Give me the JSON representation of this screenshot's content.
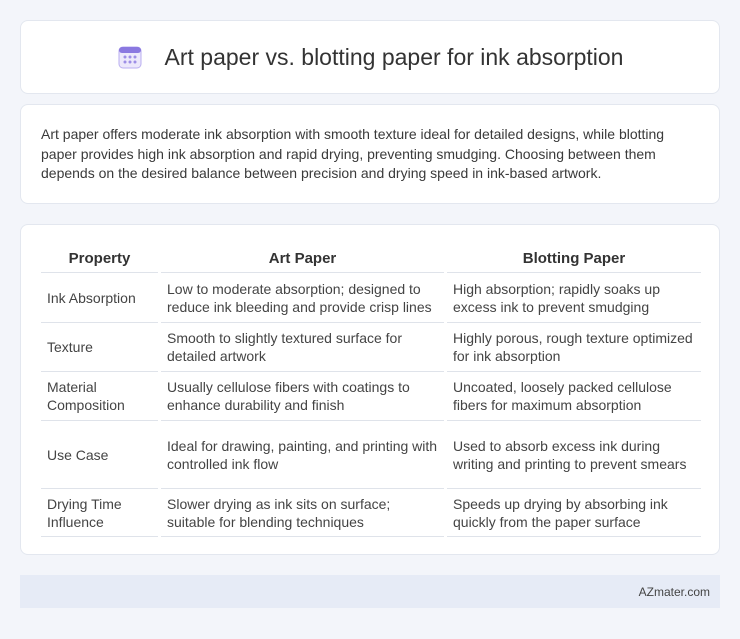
{
  "header": {
    "title": "Art paper vs. blotting paper for ink absorption",
    "icon": "calendar-icon",
    "accent": "#8a78e0"
  },
  "intro": {
    "text": "Art paper offers moderate ink absorption with smooth texture ideal for detailed designs, while blotting paper provides high ink absorption and rapid drying, preventing smudging. Choosing between them depends on the desired balance between precision and drying speed in ink-based artwork."
  },
  "table": {
    "headers": [
      "Property",
      "Art Paper",
      "Blotting Paper"
    ],
    "rows": [
      [
        "Ink Absorption",
        "Low to moderate absorption; designed to reduce ink bleeding and provide crisp lines",
        "High absorption; rapidly soaks up excess ink to prevent smudging"
      ],
      [
        "Texture",
        "Smooth to slightly textured surface for detailed artwork",
        "Highly porous, rough texture optimized for ink absorption"
      ],
      [
        "Material Composition",
        "Usually cellulose fibers with coatings to enhance durability and finish",
        "Uncoated, loosely packed cellulose fibers for maximum absorption"
      ],
      [
        "Use Case",
        "Ideal for drawing, painting, and printing with controlled ink flow",
        "Used to absorb excess ink during writing and printing to prevent smears"
      ],
      [
        "Drying Time Influence",
        "Slower drying as ink sits on surface; suitable for blending techniques",
        "Speeds up drying by absorbing ink quickly from the paper surface"
      ]
    ]
  },
  "footer": {
    "text": "AZmater.com"
  }
}
